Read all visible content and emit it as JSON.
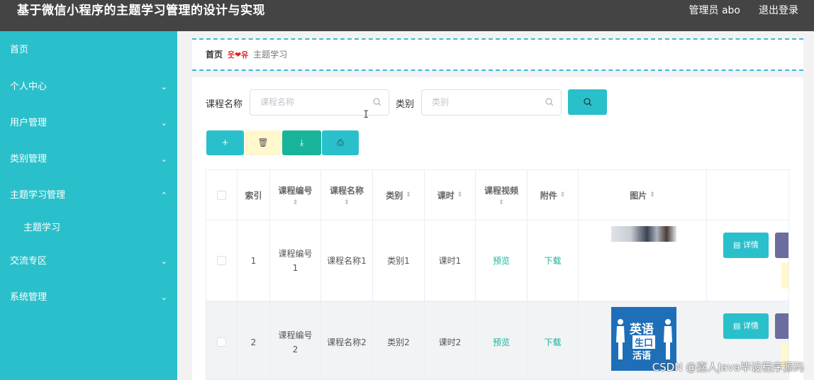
{
  "app": {
    "title": "基于微信小程序的主题学习管理的设计与实现",
    "admin_label": "管理员 abo",
    "logout_label": "退出登录"
  },
  "sidebar": {
    "items": [
      {
        "label": "首页"
      },
      {
        "label": "个人中心",
        "arrow": "⌄"
      },
      {
        "label": "用户管理",
        "arrow": "⌄"
      },
      {
        "label": "类别管理",
        "arrow": "⌄"
      },
      {
        "label": "主题学习管理",
        "arrow": "⌃"
      },
      {
        "label": "交流专区",
        "arrow": "⌄"
      },
      {
        "label": "系统管理",
        "arrow": "⌄"
      }
    ],
    "submenu": [
      {
        "label": "主题学习"
      }
    ]
  },
  "breadcrumb": {
    "home": "首页",
    "separator": "웃❤유",
    "current": "主题学习"
  },
  "search": {
    "course_name_label": "课程名称",
    "course_name_placeholder": "课程名称",
    "category_label": "类别",
    "category_placeholder": "类别"
  },
  "toolbar": {
    "add": "+",
    "delete": "🗑",
    "export": "⤓",
    "print": "⎙"
  },
  "table": {
    "headers": {
      "index": "索引",
      "course_no": "课程编号",
      "course_name": "课程名称",
      "category": "类别",
      "hours": "课时",
      "video": "课程视频",
      "attachment": "附件",
      "image": "图片"
    },
    "sort_icon": "⇕",
    "rows": [
      {
        "index": "1",
        "course_no": "课程编号1",
        "course_name": "课程名称1",
        "category": "类别1",
        "hours": "课时1",
        "video": "预览",
        "attachment": "下载",
        "detail": "详情"
      },
      {
        "index": "2",
        "course_no": "课程编号2",
        "course_name": "课程名称2",
        "category": "类别2",
        "hours": "课时2",
        "video": "预览",
        "attachment": "下载",
        "detail": "详情"
      }
    ]
  },
  "image_2_text": {
    "line1": "英语",
    "line2": "生口",
    "line3": "活语"
  },
  "watermark": "CSDN @嘉人Java毕设程序源码",
  "colors": {
    "topbar": "#444444",
    "sidebar": "#2ac0cb",
    "accent": "#2ac0cb",
    "delete_btn": "#fff8cc",
    "export_btn": "#19b39a",
    "print_btn": "#2ac0cb",
    "edit_btn": "#6b6d9e",
    "link": "#19b39a"
  },
  "icons": {
    "search": "search-icon",
    "sort": "sort-icon",
    "detail": "document-icon",
    "edit": "edit-icon"
  }
}
